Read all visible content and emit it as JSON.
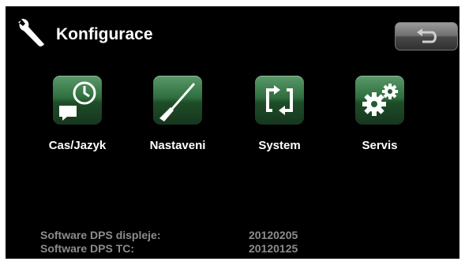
{
  "header": {
    "title": "Konfigurace",
    "icon": "wrench-icon",
    "back_icon": "back-arrow-icon"
  },
  "tiles": [
    {
      "label": "Cas/Jazyk",
      "icon": "clock-speech-icon"
    },
    {
      "label": "Nastaveni",
      "icon": "screwdriver-icon"
    },
    {
      "label": "System",
      "icon": "refresh-arrows-icon"
    },
    {
      "label": "Servis",
      "icon": "gears-icon"
    }
  ],
  "software": [
    {
      "label": "Software DPS displeje:",
      "value": "20120205"
    },
    {
      "label": "Software DPS TC:",
      "value": "20120125"
    }
  ],
  "colors": {
    "background": "#000000",
    "tile_green": "#2f6e3e",
    "text": "#ffffff",
    "info_text": "#8c8c8c"
  }
}
